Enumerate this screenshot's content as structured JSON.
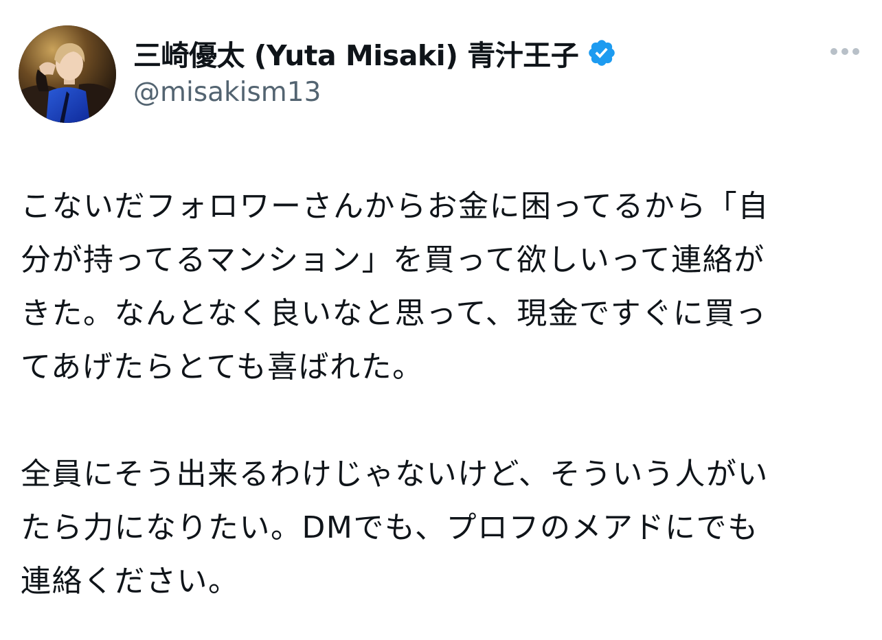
{
  "tweet": {
    "author": {
      "display_name": "三崎優太 (Yuta Misaki) 青汁王子",
      "handle": "@misakism13",
      "verified": true,
      "verified_icon": "verified-badge-icon",
      "avatar_icon": "avatar"
    },
    "more_icon": "more-options-icon",
    "paragraphs": [
      "こないだフォロワーさんからお金に困ってるから「自\n分が持ってるマンション」を買って欲しいって連絡が\nきた。なんとなく良いなと思って、現金ですぐに買っ\nてあげたらとても喜ばれた。",
      "全員にそう出来るわけじゃないけど、そういう人がい\nたら力になりたい。DMでも、プロフのメアドにでも\n連絡ください。"
    ]
  },
  "colors": {
    "text_primary": "#0f1419",
    "text_secondary": "#536471",
    "verified_blue": "#1d9bf0",
    "background": "#ffffff"
  }
}
